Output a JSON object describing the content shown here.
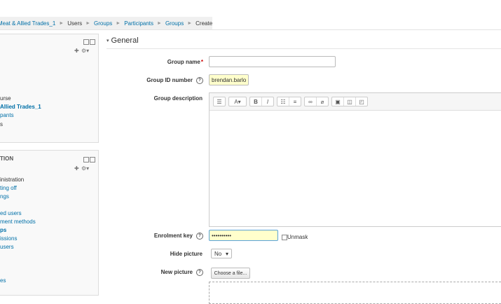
{
  "breadcrumb": [
    "Meat & Allied Trades_1",
    "Users",
    "Groups",
    "Participants",
    "Groups",
    "Create group"
  ],
  "sidebar": {
    "course_items": [
      "urse",
      "Allied Trades_1",
      "pants",
      "s"
    ],
    "admin_title": "TION",
    "admin_items": [
      "inistration",
      "ting off",
      "ngs",
      "",
      "ed users",
      "ment methods",
      "ps",
      "issions",
      "users",
      "",
      "",
      "es"
    ]
  },
  "form": {
    "legend": "General",
    "group_name_label": "Group name",
    "group_name_value": "",
    "group_id_label": "Group ID number",
    "group_id_value": "brendan.barlow",
    "description_label": "Group description",
    "enrolment_key_label": "Enrolment key",
    "enrolment_key_value": "••••••••••",
    "unmask_label": "Unmask",
    "hide_picture_label": "Hide picture",
    "hide_picture_value": "No",
    "new_picture_label": "New picture",
    "choose_file_label": "Choose a file..."
  },
  "icons": {
    "help": "?",
    "dropdown_arrow": "▾",
    "legend_toggle": "▾"
  }
}
